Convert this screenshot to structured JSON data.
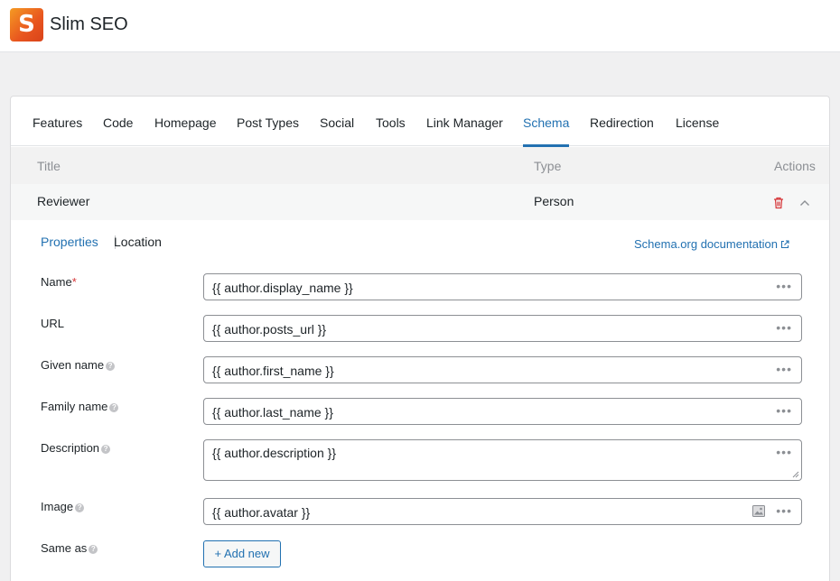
{
  "app": {
    "logo_letter": "S",
    "title": "Slim SEO"
  },
  "tabs": [
    "Features",
    "Code",
    "Homepage",
    "Post Types",
    "Social",
    "Tools",
    "Link Manager",
    "Schema",
    "Redirection",
    "License"
  ],
  "active_tab": "Schema",
  "table": {
    "headers": {
      "title": "Title",
      "type": "Type",
      "actions": "Actions"
    },
    "row": {
      "title": "Reviewer",
      "type": "Person"
    }
  },
  "subtabs": {
    "properties": "Properties",
    "location": "Location"
  },
  "doc_link": "Schema.org documentation",
  "fields": {
    "name": {
      "label": "Name",
      "required": "*",
      "value": "{{ author.display_name }}"
    },
    "url": {
      "label": "URL",
      "value": "{{ author.posts_url }}"
    },
    "given_name": {
      "label": "Given name",
      "value": "{{ author.first_name }}"
    },
    "family_name": {
      "label": "Family name",
      "value": "{{ author.last_name }}"
    },
    "description": {
      "label": "Description",
      "value": "{{ author.description }}"
    },
    "image": {
      "label": "Image",
      "value": "{{ author.avatar }}"
    },
    "same_as": {
      "label": "Same as"
    }
  },
  "add_new_label": "+ Add new",
  "icons": {
    "help": "?",
    "more": "•••"
  },
  "colors": {
    "accent": "#2271b1",
    "danger": "#d63638",
    "logo_orange": "#e8551f"
  }
}
